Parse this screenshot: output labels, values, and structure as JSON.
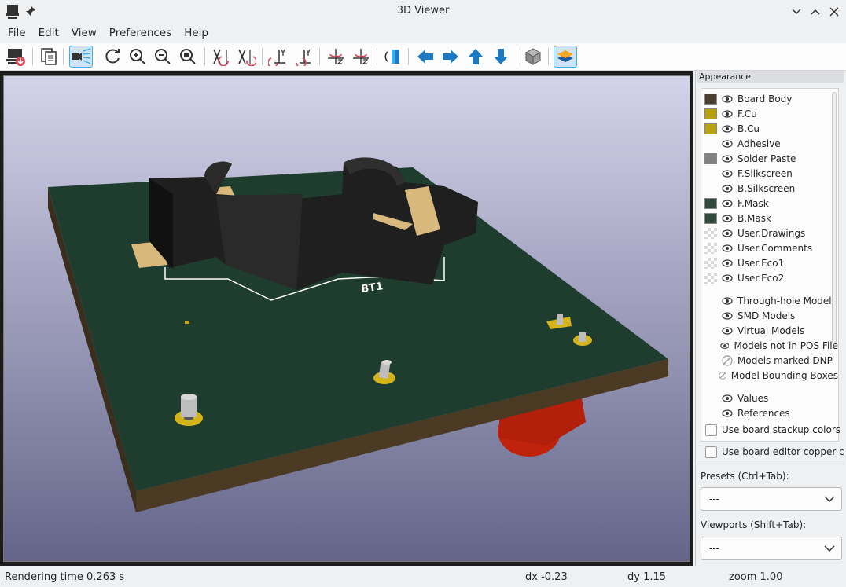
{
  "window": {
    "title": "3D Viewer"
  },
  "menu": [
    "File",
    "Edit",
    "View",
    "Preferences",
    "Help"
  ],
  "toolbar": {
    "icons": [
      "export-icon",
      "copy-icon",
      "raytrace-icon",
      "reload-icon",
      "zoom-in-icon",
      "zoom-out-icon",
      "zoom-fit-icon",
      "rotate-x-cw-icon",
      "rotate-x-ccw-icon",
      "rotate-y-cw-icon",
      "rotate-y-ccw-icon",
      "rotate-z-cw-icon",
      "rotate-z-ccw-icon",
      "flip-board-icon",
      "pan-left-icon",
      "pan-right-icon",
      "pan-up-icon",
      "pan-down-icon",
      "orthographic-icon",
      "layers-icon"
    ]
  },
  "viewport": {
    "silkscreen_reference": "BT1"
  },
  "panel": {
    "title": "Appearance",
    "layers": [
      {
        "label": "Board Body",
        "color": "#4a3f2f",
        "swatch": "solid"
      },
      {
        "label": "F.Cu",
        "color": "#b9a210",
        "swatch": "solid"
      },
      {
        "label": "B.Cu",
        "color": "#b9a210",
        "swatch": "solid"
      },
      {
        "label": "Adhesive",
        "color": "",
        "swatch": "none"
      },
      {
        "label": "Solder Paste",
        "color": "#808080",
        "swatch": "solid"
      },
      {
        "label": "F.Silkscreen",
        "color": "",
        "swatch": "none"
      },
      {
        "label": "B.Silkscreen",
        "color": "",
        "swatch": "none"
      },
      {
        "label": "F.Mask",
        "color": "#2f4a3d",
        "swatch": "solid"
      },
      {
        "label": "B.Mask",
        "color": "#2f4a3d",
        "swatch": "solid"
      },
      {
        "label": "User.Drawings",
        "color": "",
        "swatch": "checker"
      },
      {
        "label": "User.Comments",
        "color": "",
        "swatch": "checker"
      },
      {
        "label": "User.Eco1",
        "color": "",
        "swatch": "checker"
      },
      {
        "label": "User.Eco2",
        "color": "",
        "swatch": "checker"
      }
    ],
    "model_layers": [
      {
        "label": "Through-hole Models",
        "icon": "eye"
      },
      {
        "label": "SMD Models",
        "icon": "eye"
      },
      {
        "label": "Virtual Models",
        "icon": "eye"
      },
      {
        "label": "Models not in POS File",
        "icon": "eye"
      },
      {
        "label": "Models marked DNP",
        "icon": "disabled"
      },
      {
        "label": "Model Bounding Boxes",
        "icon": "disabled"
      }
    ],
    "text_layers": [
      {
        "label": "Values",
        "icon": "eye"
      },
      {
        "label": "References",
        "icon": "eye"
      }
    ],
    "checkboxes": [
      {
        "label": "Use board stackup colors",
        "checked": false
      },
      {
        "label": "Use board editor copper colors",
        "checked": false
      }
    ],
    "presets": {
      "label": "Presets (Ctrl+Tab):",
      "value": "---"
    },
    "viewports": {
      "label": "Viewports (Shift+Tab):",
      "value": "---"
    }
  },
  "status": {
    "render": "Rendering time 0.263 s",
    "dx": "dx -0.23",
    "dy": "dy 1.15",
    "zoom": "zoom 1.00"
  }
}
